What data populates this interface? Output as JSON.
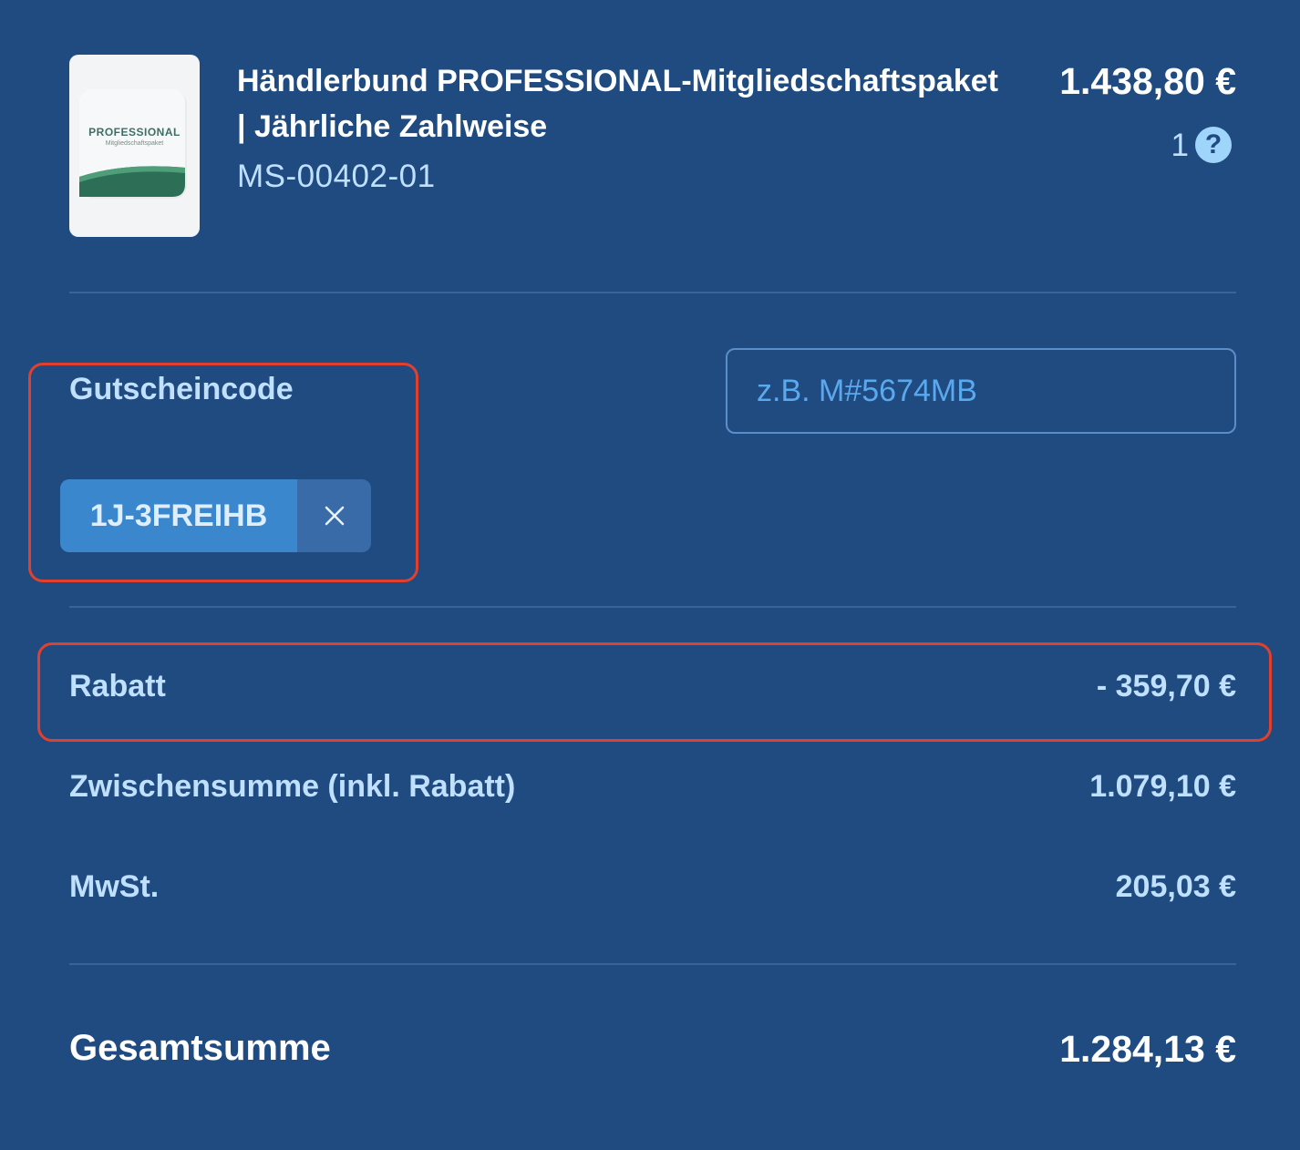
{
  "product": {
    "image": {
      "title": "PROFESSIONAL",
      "subtitle": "Mitgliedschaftspaket"
    },
    "title_line1": "Händlerbund PROFESSIONAL-Mitgliedschaftspaket",
    "title_line2": "| Jährliche Zahlweise",
    "sku": "MS-00402-01",
    "price": "1.438,80 €",
    "quantity": "1",
    "help_symbol": "?"
  },
  "coupon": {
    "label": "Gutscheincode",
    "input_placeholder": "z.B. M#5674MB",
    "input_value": "",
    "applied_code": "1J-3FREIHB",
    "remove_icon": "close-icon"
  },
  "totals": {
    "discount_label": "Rabatt",
    "discount_value": "- 359,70 €",
    "subtotal_label": "Zwischensumme (inkl. Rabatt)",
    "subtotal_value": "1.079,10 €",
    "tax_label": "MwSt.",
    "tax_value": "205,03 €",
    "grand_total_label": "Gesamtsumme",
    "grand_total_value": "1.284,13 €"
  },
  "colors": {
    "background": "#204b81",
    "accent_light": "#bfe0ff",
    "chip": "#3b87ce",
    "highlight": "#e0402d"
  }
}
